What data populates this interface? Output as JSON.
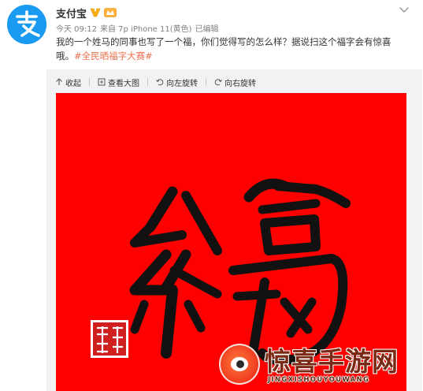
{
  "post": {
    "author": "支付宝",
    "meta": {
      "time": "今天 09:12",
      "source": "来自 7p iPhone 11(黄色)",
      "edited": "已编辑"
    },
    "text": "我的一个姓马的同事也写了一个福，你们觉得写的怎么样？据说扫这个福字会有惊喜哦。",
    "hashtag": "#全民晒福字大赛#"
  },
  "toolbar": {
    "collapse": "收起",
    "view_large": "查看大图",
    "rotate_left": "向左旋转",
    "rotate_right": "向右旋转"
  },
  "watermark": {
    "title": "惊喜手游网",
    "subtitle": "JINGXISHOUYOUWANG"
  },
  "colors": {
    "brand_blue": "#1a9af0",
    "link_orange": "#eb7350",
    "poster_red": "#ff0000",
    "ink": "#111111"
  },
  "icons": [
    "alipay-logo-icon",
    "verified-v-icon",
    "level-badge-icon",
    "more-chevron-icon",
    "collapse-arrow-icon",
    "zoom-icon",
    "rotate-left-icon",
    "rotate-right-icon"
  ]
}
